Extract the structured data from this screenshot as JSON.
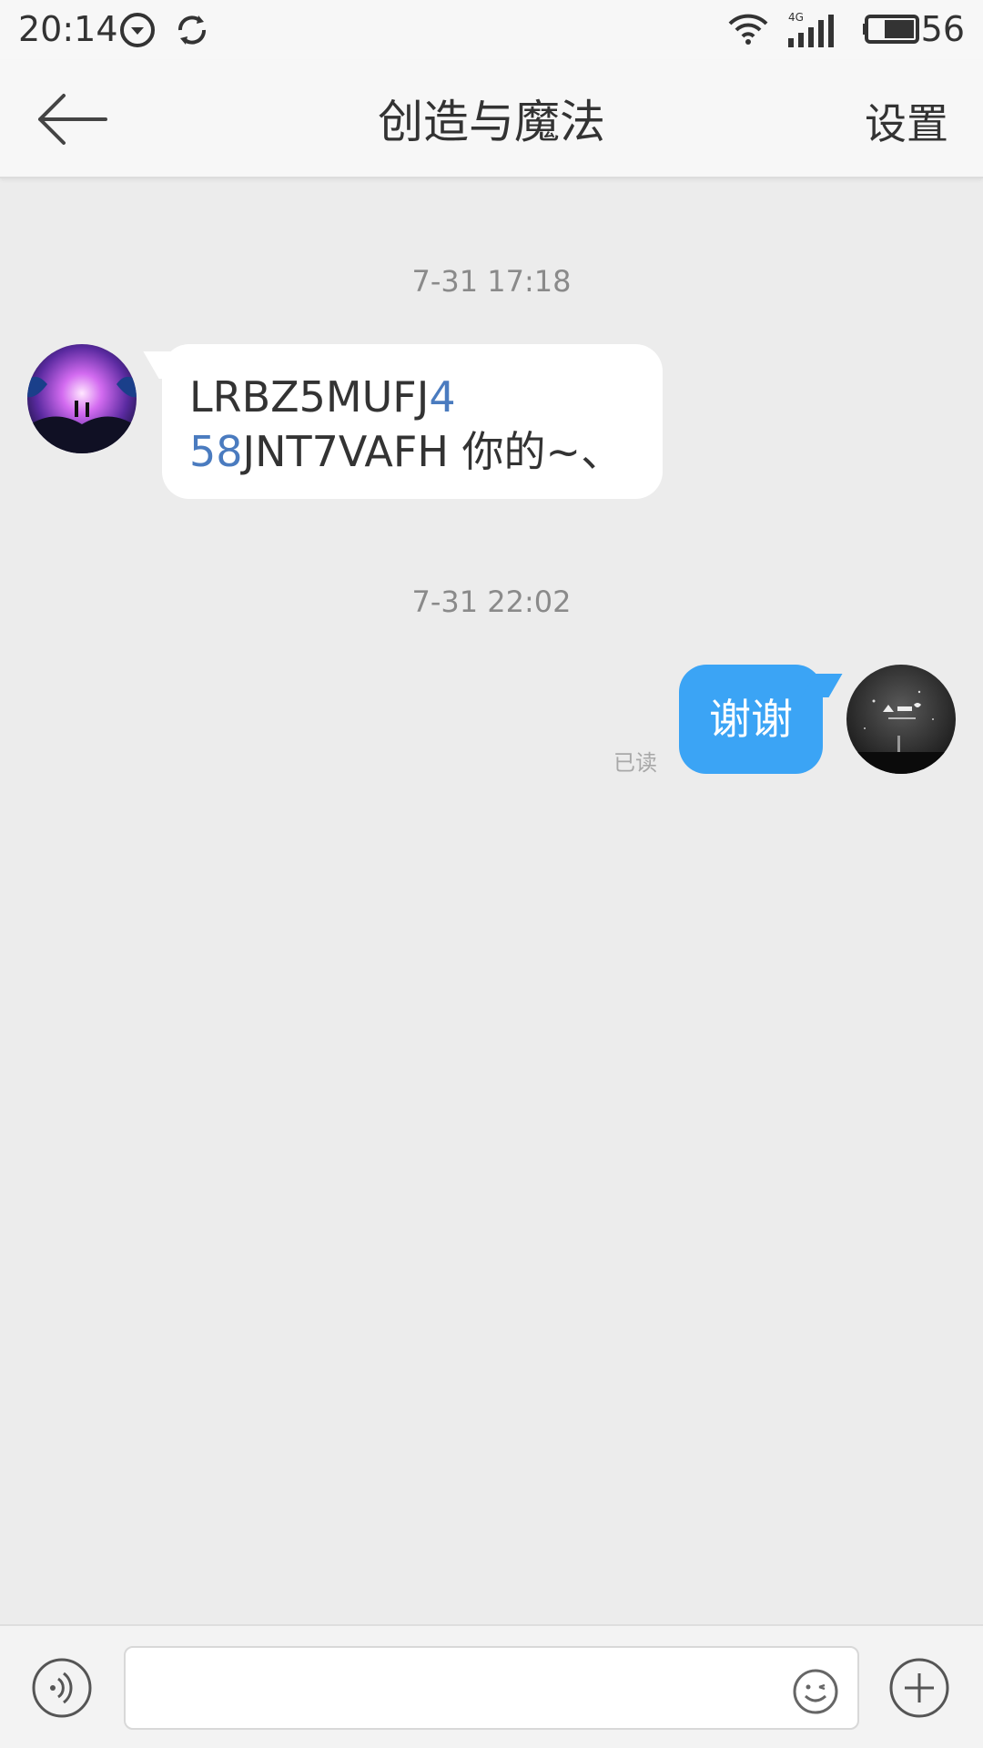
{
  "status_bar": {
    "time": "20:14",
    "battery_percent": "56",
    "network_label": "4G",
    "icons": [
      "download-icon",
      "sync-icon",
      "wifi-icon",
      "signal-icon",
      "battery-icon"
    ]
  },
  "header": {
    "title": "创造与魔法",
    "settings_label": "设置",
    "back_icon": "back-arrow-icon"
  },
  "messages": [
    {
      "timestamp": "7-31 17:18",
      "direction": "incoming",
      "avatar_icon": "avatar-icon",
      "text_line1": "LRBZ5MUFJ",
      "text_line1_link": "4",
      "text_line2_link": "58",
      "text_line2": "JNT7VAFH  你的~、"
    },
    {
      "timestamp": "7-31 22:02",
      "direction": "outgoing",
      "avatar_icon": "avatar-icon",
      "text": "谢谢",
      "status": "已读"
    }
  ],
  "input_bar": {
    "voice_icon": "voice-icon",
    "emoji_icon": "emoji-icon",
    "plus_icon": "plus-icon",
    "input_value": ""
  },
  "colors": {
    "background": "#ececec",
    "outgoing_bubble": "#3ba4f5",
    "link_text": "#4a7bbf"
  }
}
